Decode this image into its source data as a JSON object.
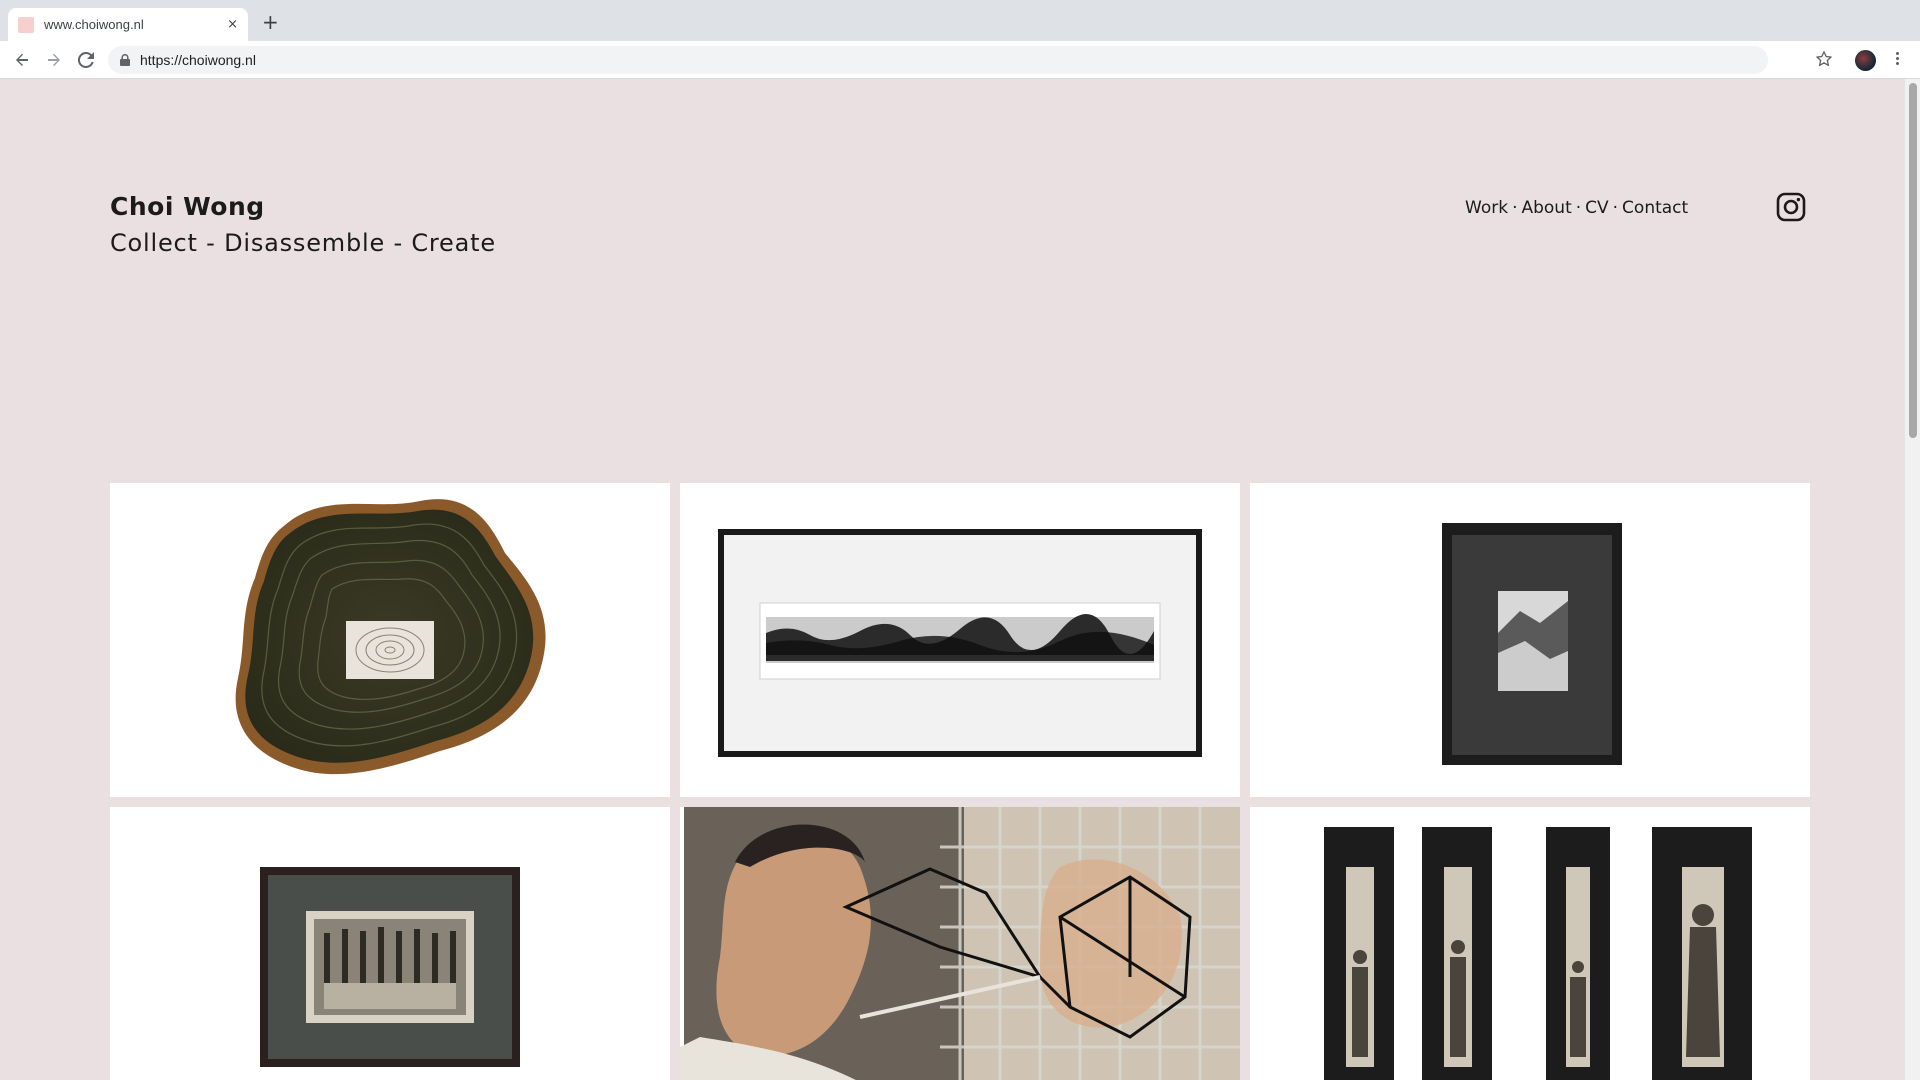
{
  "browser": {
    "tab_title": "www.choiwong.nl",
    "tab_close": "×",
    "new_tab": "+",
    "url": "https://choiwong.nl"
  },
  "site": {
    "title": "Choi Wong",
    "tagline": "Collect - Disassemble - Create"
  },
  "nav": {
    "items": [
      "Work",
      "About",
      "CV",
      "Contact"
    ],
    "separator": "·"
  },
  "colors": {
    "page_background": "#ebe0e1",
    "tile_background": "#ffffff",
    "text": "#1b1b1b"
  },
  "icons": {
    "back": "back-arrow-icon",
    "forward": "forward-arrow-icon",
    "reload": "reload-icon",
    "lock": "lock-icon",
    "bookmark": "star-icon",
    "menu": "kebab-menu-icon",
    "social": "instagram-icon"
  },
  "gallery": {
    "items": [
      "tree-ring-artwork",
      "long-landscape-print-framed",
      "small-photo-framed-black",
      "group-photo-framed",
      "man-with-wire-geometry-photo",
      "four-narrow-portrait-frames"
    ]
  }
}
